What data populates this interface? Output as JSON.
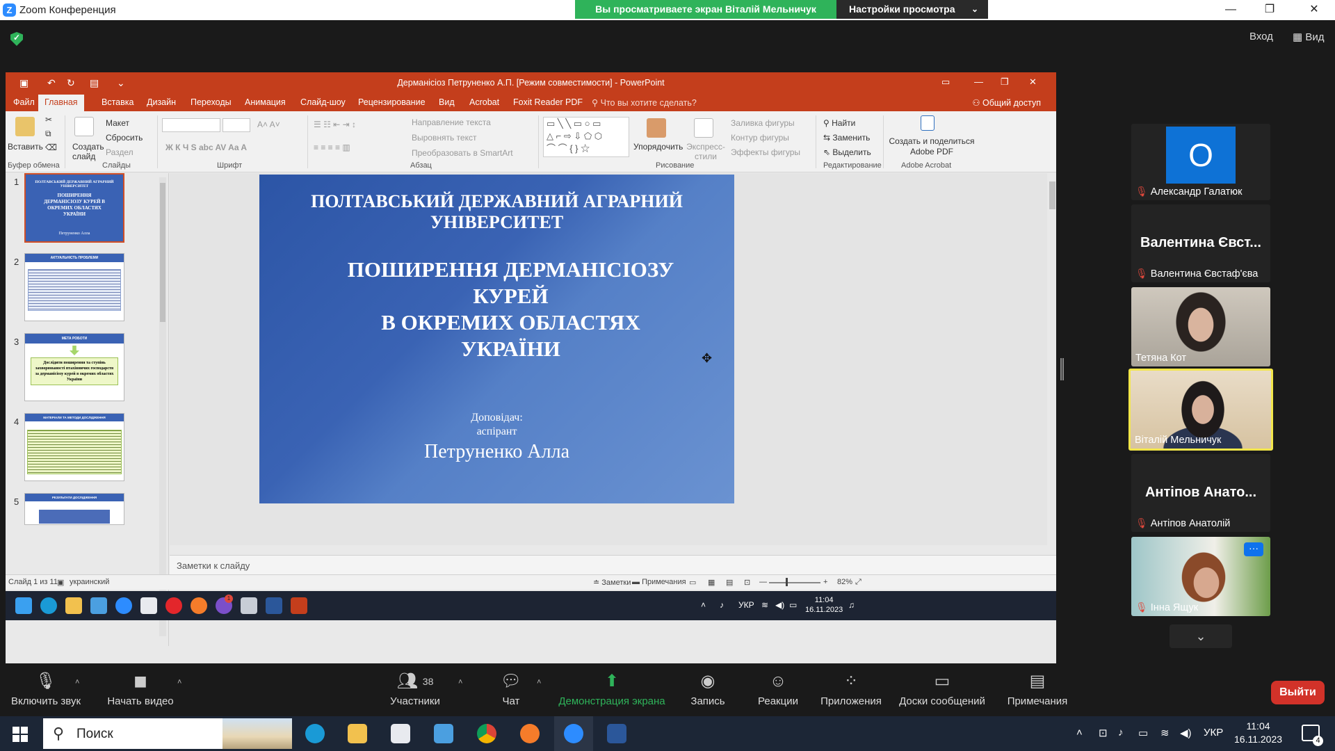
{
  "zoom": {
    "window_title": "Zoom Конференция",
    "share_banner": "Вы просматриваете экран Віталій Мельничук",
    "view_options": "Настройки просмотра",
    "sign_in": "Вход",
    "view": "Вид"
  },
  "ppt": {
    "window_title": "Дерманісіоз Петруненко А.П. [Режим совместимости] - PowerPoint",
    "tabs": [
      "Файл",
      "Главная",
      "Вставка",
      "Дизайн",
      "Переходы",
      "Анимация",
      "Слайд-шоу",
      "Рецензирование",
      "Вид",
      "Acrobat",
      "Foxit Reader PDF"
    ],
    "tell_me": "Что вы хотите сделать?",
    "share": "Общий доступ",
    "ribbon": {
      "paste": "Вставить",
      "new_slide": "Создать слайд",
      "layout": "Макет",
      "reset": "Сбросить",
      "section": "Раздел",
      "text_direction": "Направление текста",
      "align_text": "Выровнять текст",
      "smartart": "Преобразовать в SmartArt",
      "arrange": "Упорядочить",
      "quick_styles": "Экспресс-стили",
      "shape_fill": "Заливка фигуры",
      "shape_outline": "Контур фигуры",
      "shape_effects": "Эффекты фигуры",
      "find": "Найти",
      "replace": "Заменить",
      "select": "Выделить",
      "adobe_create": "Создать и поделиться Adobe PDF",
      "groups": [
        "Буфер обмена",
        "Слайды",
        "Шрифт",
        "Абзац",
        "Рисование",
        "Редактирование",
        "Adobe Acrobat"
      ]
    },
    "thumbnails": [
      {
        "num": "1",
        "title": "ПОЛТАВСЬКИЙ ДЕРЖАВНИЙ АГРАРНИЙ УНІВЕРСИТЕТ",
        "sub": "ПОШИРЕННЯ ДЕРМАНІСІОЗУ КУРЕЙ В ОКРЕМИХ ОБЛАСТЯХ УКРАЇНИ",
        "author": "Петруненко Алла"
      },
      {
        "num": "2",
        "title": "АКТУАЛЬНІСТЬ ПРОБЛЕМИ"
      },
      {
        "num": "3",
        "title": "МЕТА РОБОТИ",
        "body": "Дослідити поширення та ступінь захворюваності птахівничих господарств за дерманісіозу курей в окремих областях України"
      },
      {
        "num": "4",
        "title": "МАТЕРІАЛИ ТА МЕТОДИ ДОСЛІДЖЕННЯ"
      },
      {
        "num": "5",
        "title": "РЕЗУЛЬТАТИ ДОСЛІДЖЕННЯ"
      }
    ],
    "slide": {
      "university": "ПОЛТАВСЬКИЙ ДЕРЖАВНИЙ АГРАРНИЙ УНІВЕРСИТЕТ",
      "topic_line1": "ПОШИРЕННЯ ДЕРМАНІСІОЗУ",
      "topic_line2": "КУРЕЙ",
      "topic_line3": "В ОКРЕМИХ ОБЛАСТЯХ",
      "topic_line4": "УКРАЇНИ",
      "speaker_label": "Доповідач:",
      "speaker_role": "аспірант",
      "speaker_name": "Петруненко Алла"
    },
    "notes_placeholder": "Заметки к слайду",
    "status": {
      "slide_counter": "Слайд 1 из 11",
      "language": "украинский",
      "notes": "Заметки",
      "comments": "Примечания",
      "zoom": "82%"
    },
    "remote_taskbar": {
      "lang": "УКР",
      "time": "11:04",
      "date": "16.11.2023",
      "badge": "1"
    }
  },
  "participants": [
    {
      "name": "Александр Галатюк",
      "avatar_letter": "O",
      "muted": true
    },
    {
      "name": "Валентина Євстаф'єва",
      "big_name": "Валентина Євст...",
      "muted": true
    },
    {
      "name": "Тетяна Кот",
      "muted": false
    },
    {
      "name": "Віталій Мельничук",
      "muted": false,
      "active": true
    },
    {
      "name": "Антіпов Анатолій",
      "big_name": "Антіпов Анато...",
      "muted": true
    },
    {
      "name": "Інна Ящук",
      "muted": true
    }
  ],
  "toolbar": {
    "unmute": "Включить звук",
    "start_video": "Начать видео",
    "participants": "Участники",
    "participants_count": "38",
    "chat": "Чат",
    "share_screen": "Демонстрация экрана",
    "record": "Запись",
    "reactions": "Реакции",
    "apps": "Приложения",
    "whiteboards": "Доски сообщений",
    "notes": "Примечания",
    "leave": "Выйти"
  },
  "win_taskbar": {
    "search": "Поиск",
    "lang": "УКР",
    "time": "11:04",
    "date": "16.11.2023",
    "notifications": "4"
  }
}
